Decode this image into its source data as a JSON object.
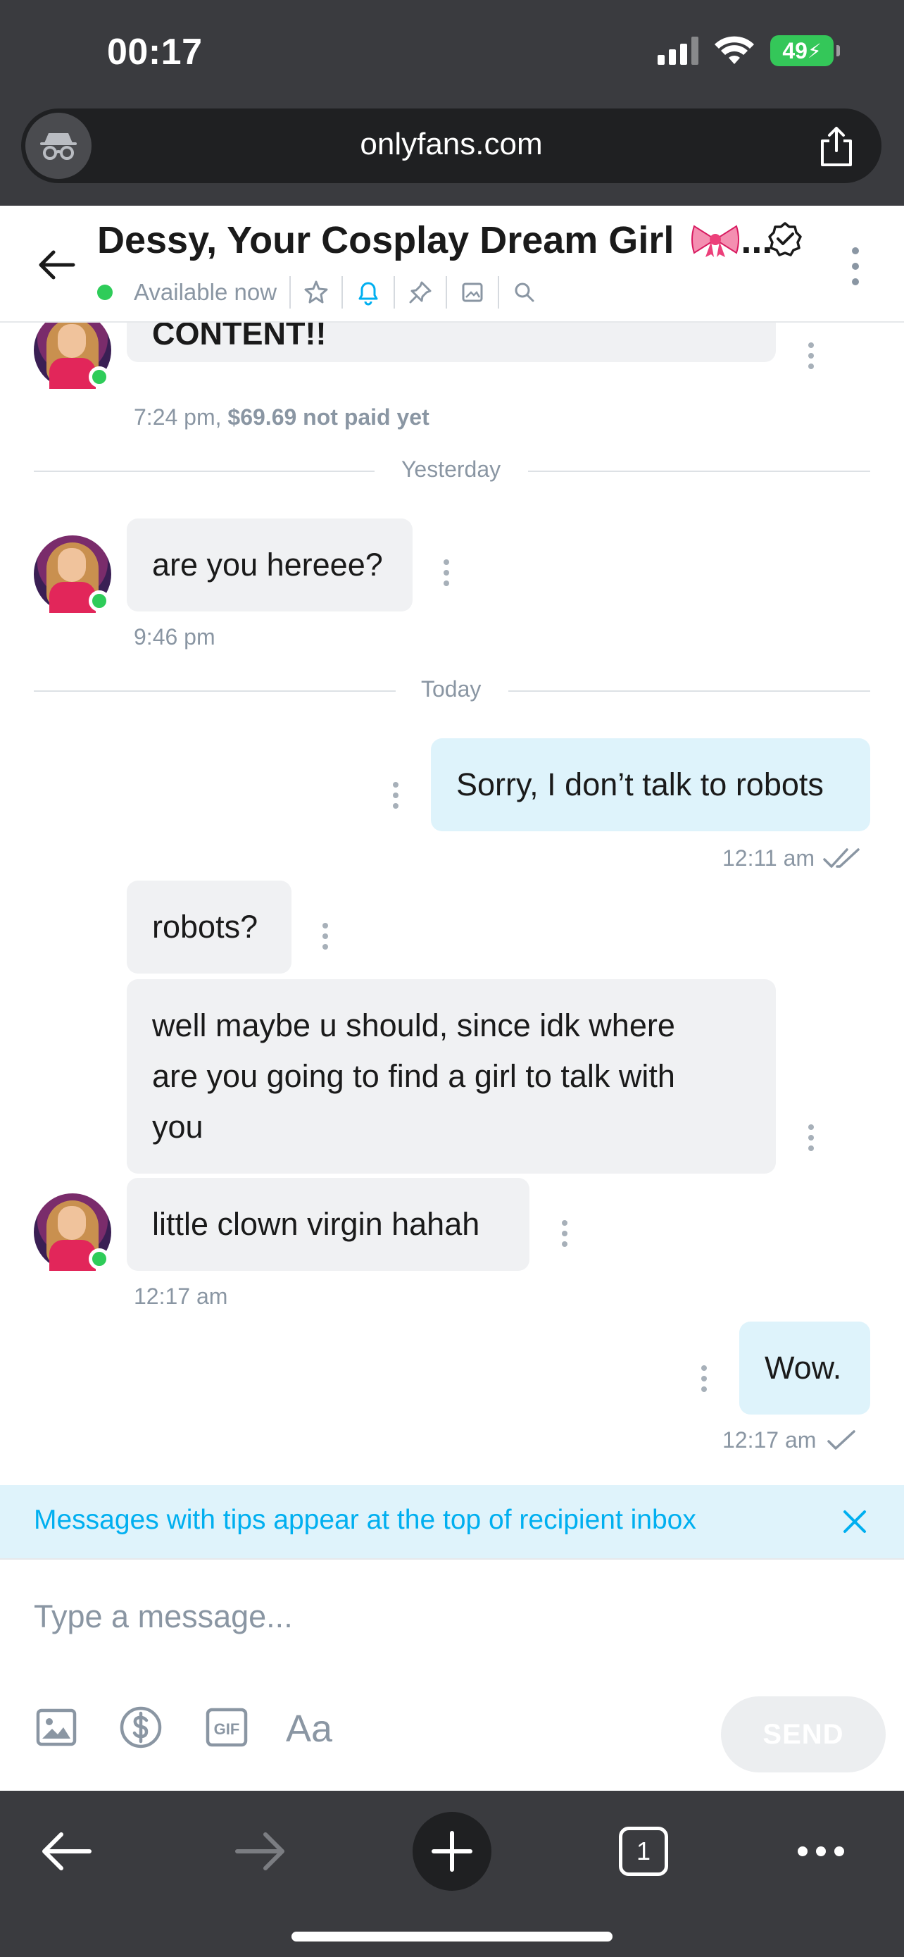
{
  "status_bar": {
    "time": "00:17",
    "battery": "49"
  },
  "browser": {
    "url": "onlyfans.com"
  },
  "chat_header": {
    "title": "Dessy, Your Cosplay Dream Girl",
    "title_suffix": "...",
    "presence": "Available now"
  },
  "messages": {
    "partial_message": "CONTENT!!",
    "partial_meta_time": "7:24 pm,",
    "partial_meta_price": "$69.69 not paid yet",
    "divider_yesterday": "Yesterday",
    "msg_hereee": "are you hereee?",
    "msg_hereee_time": "9:46 pm",
    "divider_today": "Today",
    "msg_robots_reply": "Sorry, I don’t talk to robots",
    "msg_robots_reply_time": "12:11 am",
    "msg_robots_q": "robots?",
    "msg_maybe_line1": "well maybe u should, since idk where",
    "msg_maybe_line2": "are you going to find a girl to talk with",
    "msg_maybe_line3": "you",
    "msg_clown": "little clown virgin hahah",
    "msg_clown_time": "12:17 am",
    "msg_wow": "Wow.",
    "msg_wow_time": "12:17 am"
  },
  "tip_notice": {
    "text": "Messages with tips appear at the top of recipient inbox"
  },
  "composer": {
    "placeholder": "Type a message...",
    "send_label": "SEND",
    "tools": [
      "image-icon",
      "tip-dollar-icon",
      "gif-icon",
      "text-format-icon"
    ]
  },
  "bottom_bar": {
    "tab_count": "1"
  },
  "colors": {
    "accent": "#00aff0",
    "online": "#2ecc59",
    "incoming_bubble": "#f0f1f3",
    "outgoing_bubble": "#def3fb",
    "chrome": "#3a3b3f"
  }
}
